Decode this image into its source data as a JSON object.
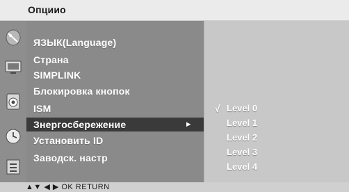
{
  "header": {
    "title": "Опциио"
  },
  "sidebar": {
    "icons": [
      "satellite-dish-icon",
      "monitor-icon",
      "speaker-icon",
      "clock-icon",
      "options-icon"
    ]
  },
  "menu": {
    "items": [
      {
        "label": "ЯЗЫК(Language)"
      },
      {
        "label": "Страна"
      },
      {
        "label": "SIMPLINK"
      },
      {
        "label": "Блокировка кнопок"
      },
      {
        "label": "ISM"
      },
      {
        "label": "Знергосбережение",
        "selected": true,
        "arrow": "►"
      },
      {
        "label": "Установить ID"
      },
      {
        "label": "Заводск. настр"
      }
    ]
  },
  "submenu": {
    "check_mark": "√",
    "options": [
      {
        "label": "Level 0",
        "checked": true
      },
      {
        "label": "Level 1"
      },
      {
        "label": "Level 2"
      },
      {
        "label": "Level 3"
      },
      {
        "label": "Level 4"
      }
    ]
  },
  "footer": {
    "hint": "▲▼  ◀ ▶  OK  RETURN"
  }
}
